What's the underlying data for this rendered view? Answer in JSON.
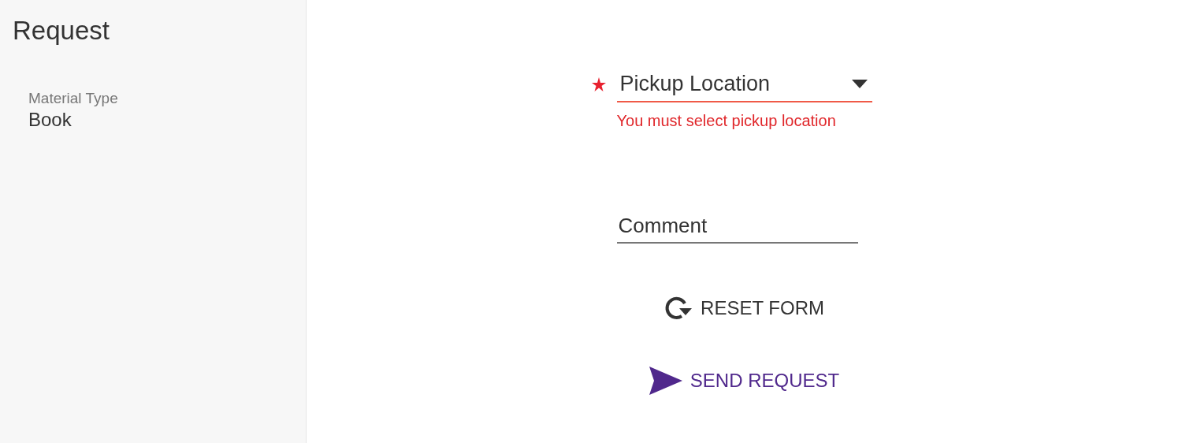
{
  "sidebar": {
    "title": "Request",
    "details": [
      {
        "label": "Material Type",
        "value": "Book"
      }
    ]
  },
  "form": {
    "fields": [
      {
        "kind": "select",
        "placeholder": "Pickup Location",
        "required": true,
        "error": "You must select pickup location"
      },
      {
        "kind": "text",
        "placeholder": "Comment",
        "required": false
      }
    ],
    "actions": [
      {
        "kind": "reset",
        "label": "RESET FORM"
      },
      {
        "kind": "send",
        "label": "SEND REQUEST"
      }
    ]
  }
}
